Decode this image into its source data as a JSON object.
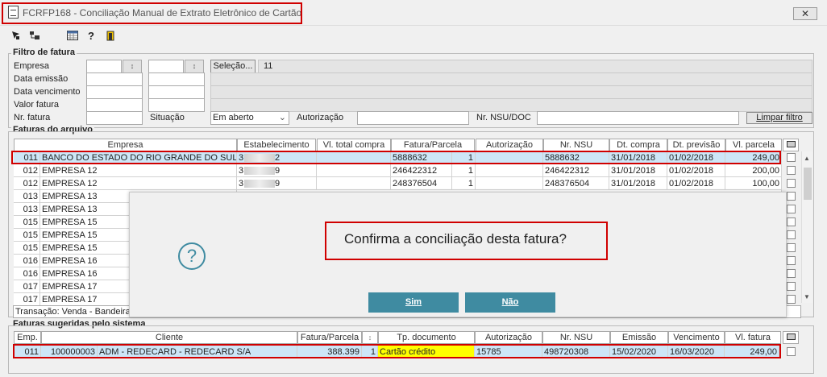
{
  "window": {
    "title": "FCRFP168 - Conciliação Manual de Extrato Eletrônico de Cartão",
    "close_glyph": "✕"
  },
  "toolbar": {
    "icons": [
      "cursor-icon",
      "tree-icon",
      "calendar-icon",
      "help-icon",
      "exit-icon"
    ],
    "help_glyph": "?"
  },
  "filter": {
    "group_label": "Filtro de fatura",
    "empresa_label": "Empresa",
    "data_emissao_label": "Data emissão",
    "data_vencimento_label": "Data vencimento",
    "valor_fatura_label": "Valor fatura",
    "nr_fatura_label": "Nr. fatura",
    "situacao_label": "Situação",
    "situacao_value": "Em aberto",
    "autorizacao_label": "Autorização",
    "nsu_label": "Nr. NSU/DOC",
    "selecao_button": "Seleção...",
    "selecao_value": "11",
    "limpar_button": "Limpar filtro",
    "lookup_glyph": "↕"
  },
  "faturas_arquivo": {
    "group_label": "Faturas do arquivo",
    "headers": [
      "Empresa",
      "Estabelecimento",
      "Vl. total compra",
      "Fatura/Parcela",
      "Autorização",
      "Nr. NSU",
      "Dt. compra",
      "Dt. previsão",
      "Vl. parcela"
    ],
    "rows": [
      {
        "emp": "011",
        "nome": "BANCO DO ESTADO DO RIO GRANDE DO SUL S/A",
        "estab": "3",
        "estab2": "2",
        "vltotal": "",
        "fatura": "5888632",
        "parcela": "1",
        "aut": "",
        "nsu": "5888632",
        "dtcompra": "31/01/2018",
        "dtprev": "01/02/2018",
        "vlparcela": "249,00"
      },
      {
        "emp": "012",
        "nome": "EMPRESA 12",
        "estab": "3",
        "estab2": "9",
        "vltotal": "",
        "fatura": "246422312",
        "parcela": "1",
        "aut": "",
        "nsu": "246422312",
        "dtcompra": "31/01/2018",
        "dtprev": "01/02/2018",
        "vlparcela": "200,00"
      },
      {
        "emp": "012",
        "nome": "EMPRESA 12",
        "estab": "3",
        "estab2": "9",
        "vltotal": "",
        "fatura": "248376504",
        "parcela": "1",
        "aut": "",
        "nsu": "248376504",
        "dtcompra": "31/01/2018",
        "dtprev": "01/02/2018",
        "vlparcela": "100,00"
      },
      {
        "emp": "013",
        "nome": "EMPRESA 13"
      },
      {
        "emp": "013",
        "nome": "EMPRESA 13"
      },
      {
        "emp": "015",
        "nome": "EMPRESA 15"
      },
      {
        "emp": "015",
        "nome": "EMPRESA 15"
      },
      {
        "emp": "015",
        "nome": "EMPRESA 15"
      },
      {
        "emp": "016",
        "nome": "EMPRESA 16"
      },
      {
        "emp": "016",
        "nome": "EMPRESA 16"
      },
      {
        "emp": "017",
        "nome": "EMPRESA 17"
      },
      {
        "emp": "017",
        "nome": "EMPRESA 17"
      }
    ],
    "status": "Transação: Venda - Bandeira"
  },
  "faturas_sugeridas": {
    "group_label": "Faturas sugeridas pelo sistema",
    "headers": [
      "Emp.",
      "Cliente",
      "Fatura/Parcela",
      "Tp. documento",
      "Autorização",
      "Nr. NSU",
      "Emissão",
      "Vencimento",
      "Vl. fatura"
    ],
    "row": {
      "emp": "011",
      "cod": "100000003",
      "cliente": "ADM - REDECARD - REDECARD S/A",
      "fatura": "388.399",
      "parcela": "1",
      "tpdoc": "Cartão crédito",
      "aut": "15785",
      "nsu": "498720308",
      "emissao": "15/02/2020",
      "vencimento": "16/03/2020",
      "vlfatura": "249,00"
    }
  },
  "dialog": {
    "message": "Confirma a conciliação desta fatura?",
    "icon_glyph": "?",
    "sim_label": "Sim",
    "nao_label": "Não"
  },
  "colors": {
    "highlight": "#d00000",
    "dialog_button": "#3f8ba1",
    "selected_row": "#cde6f7",
    "tpdoc_highlight": "#ffff00"
  }
}
